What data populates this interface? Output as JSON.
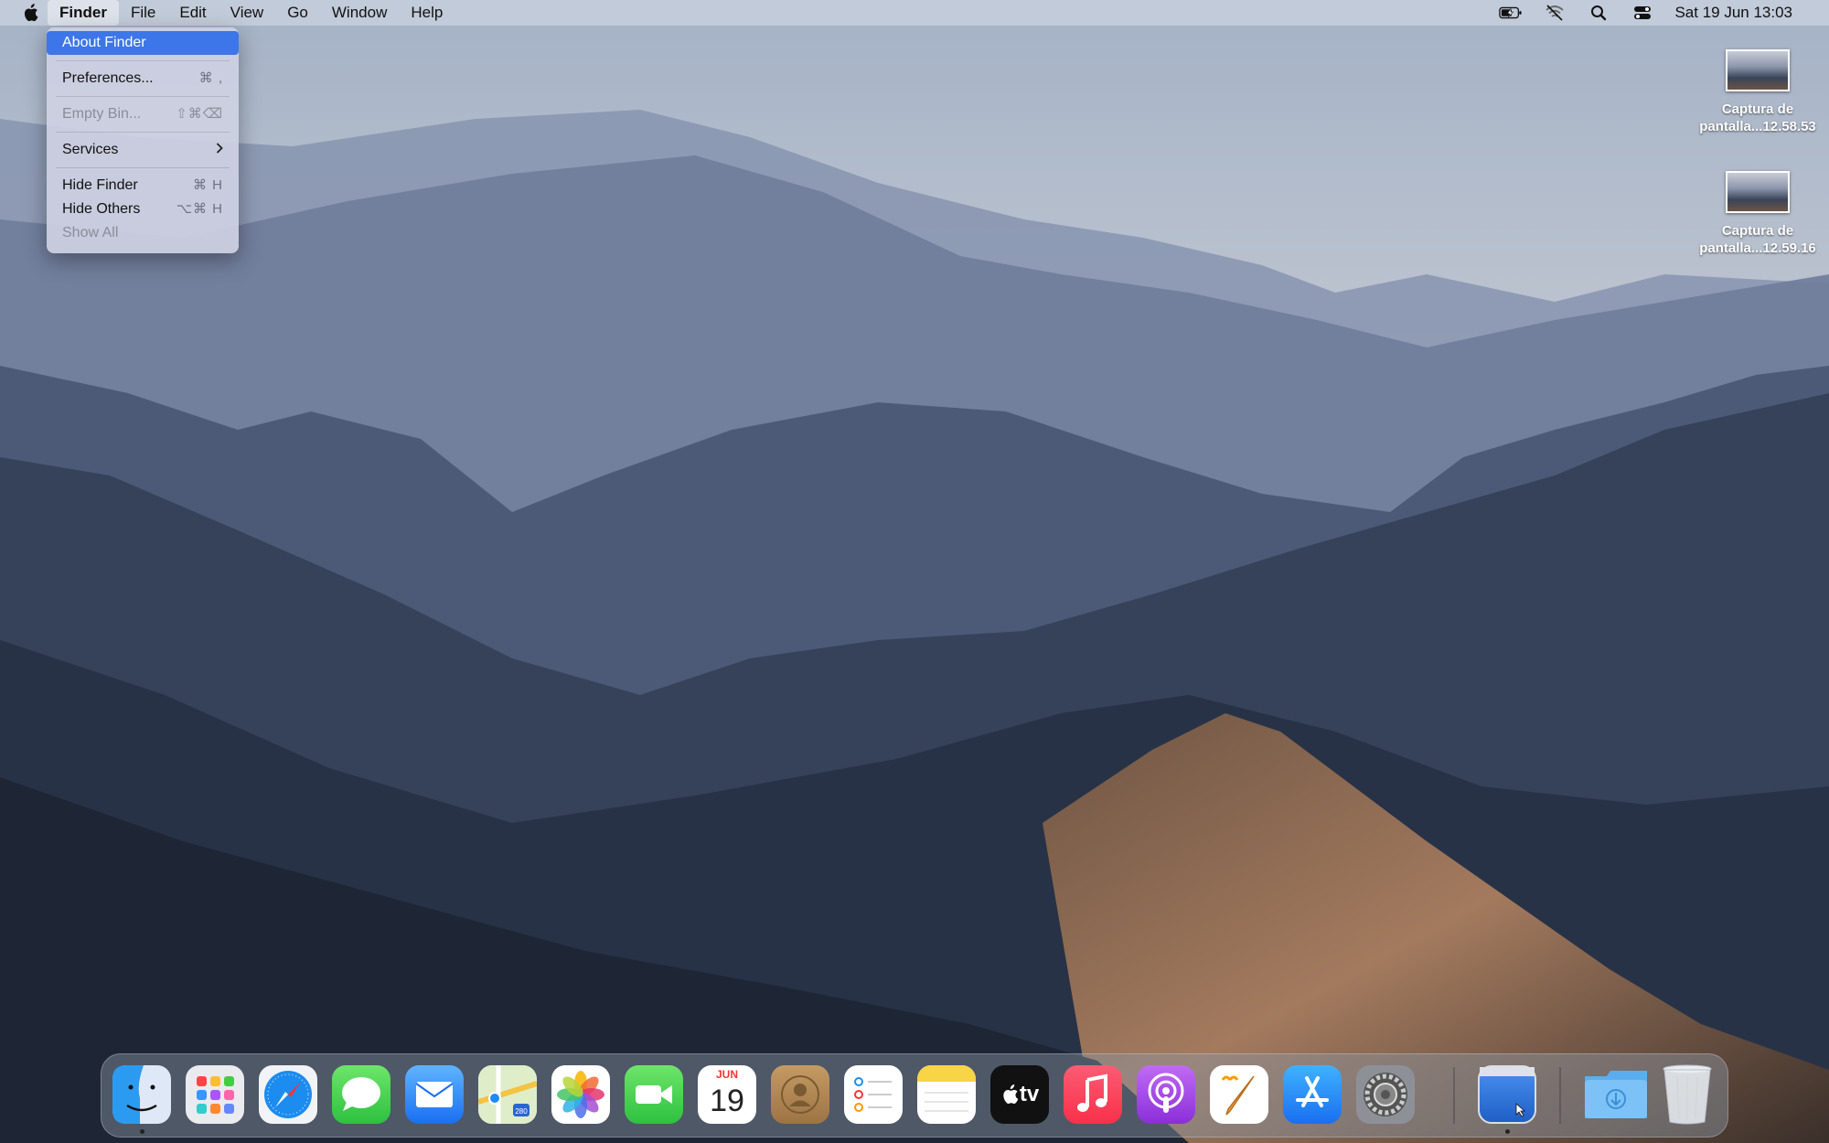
{
  "menubar": {
    "apple_icon": "apple-logo-icon",
    "app_name": "Finder",
    "menus": [
      "File",
      "Edit",
      "View",
      "Go",
      "Window",
      "Help"
    ],
    "status_icons": [
      "battery-charging-icon",
      "wifi-off-icon",
      "search-icon",
      "control-center-icon"
    ],
    "clock": "Sat 19 Jun  13:03"
  },
  "finder_menu": {
    "about": "About Finder",
    "preferences": "Preferences...",
    "preferences_shortcut": "⌘ ,",
    "empty_bin": "Empty Bin...",
    "empty_bin_shortcut": "⇧⌘⌫",
    "services": "Services",
    "hide_finder": "Hide Finder",
    "hide_finder_shortcut": "⌘ H",
    "hide_others": "Hide Others",
    "hide_others_shortcut": "⌥⌘ H",
    "show_all": "Show All"
  },
  "desktop_items": [
    {
      "line1": "Captura de",
      "line2": "pantalla...12.58.53"
    },
    {
      "line1": "Captura de",
      "line2": "pantalla...12.59.16"
    }
  ],
  "dock": {
    "apps": [
      "Finder",
      "Launchpad",
      "Safari",
      "Messages",
      "Mail",
      "Maps",
      "Photos",
      "FaceTime",
      "Calendar",
      "Contacts",
      "Reminders",
      "Notes",
      "TV",
      "Music",
      "Podcasts",
      "Pages",
      "App Store",
      "System Preferences",
      "Screen Sharing",
      "Downloads",
      "Bin"
    ],
    "calendar_month": "JUN",
    "calendar_day": "19",
    "tv_label": "tv",
    "maps_badge": "280"
  }
}
